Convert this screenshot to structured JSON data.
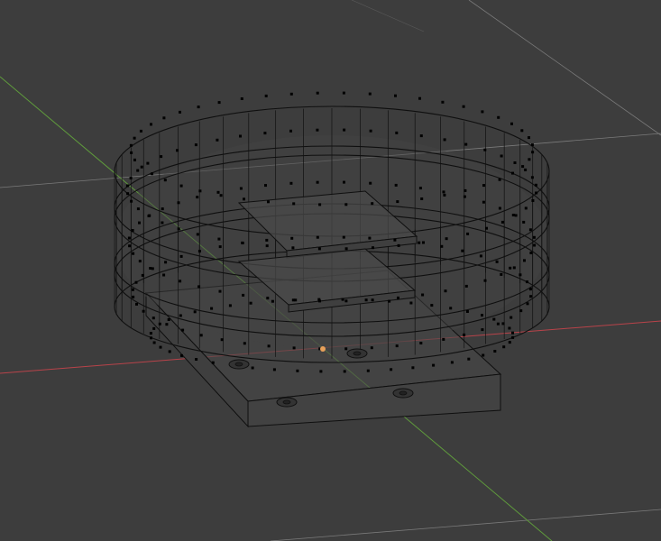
{
  "viewport": {
    "background": "#3d3d3d",
    "grid_color": "#555555",
    "x_axis_color": "#b8434a",
    "y_axis_color": "#5f9b3c",
    "wire_color": "#0f0f0f",
    "face_fill": "#454545",
    "vertex_color": "#000000",
    "origin_color": "#e8a05a"
  },
  "scene": {
    "ring_segments": 48,
    "ring_rows": 4
  }
}
